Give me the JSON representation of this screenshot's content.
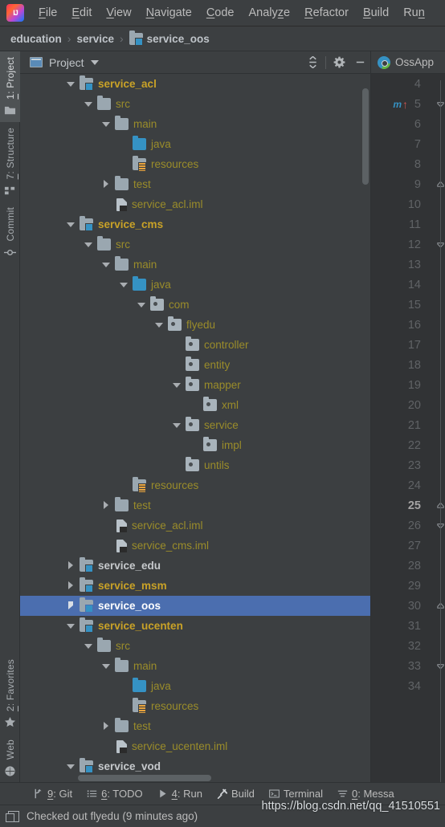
{
  "menu": {
    "logo_icon": "intellij-logo-icon",
    "items": [
      {
        "label": "File",
        "mnemonic": "F"
      },
      {
        "label": "Edit",
        "mnemonic": "E"
      },
      {
        "label": "View",
        "mnemonic": "V"
      },
      {
        "label": "Navigate",
        "mnemonic": "N"
      },
      {
        "label": "Code",
        "mnemonic": "C"
      },
      {
        "label": "Analyze",
        "mnemonic": "z"
      },
      {
        "label": "Refactor",
        "mnemonic": "R"
      },
      {
        "label": "Build",
        "mnemonic": "B"
      },
      {
        "label": "Run",
        "mnemonic": "n"
      }
    ]
  },
  "breadcrumb": {
    "separator": "›",
    "items": [
      {
        "label": "education",
        "icon": null
      },
      {
        "label": "service",
        "icon": null
      },
      {
        "label": "service_oos",
        "icon": "module-icon"
      }
    ]
  },
  "toolstrip": {
    "top": [
      {
        "label": "1: Project",
        "mnemonic": "1",
        "icon": "project-folder-icon",
        "active": true
      },
      {
        "label": "7: Structure",
        "mnemonic": "7",
        "icon": "structure-icon",
        "active": false
      },
      {
        "label": "Commit",
        "mnemonic": "",
        "icon": "commit-icon",
        "active": false
      }
    ],
    "bottom": [
      {
        "label": "2: Favorites",
        "mnemonic": "2",
        "icon": "star-icon",
        "active": false
      },
      {
        "label": "Web",
        "mnemonic": "",
        "icon": "globe-icon",
        "active": false
      }
    ]
  },
  "project_panel": {
    "title": "Project",
    "dropdown_caret_icon": "chevron-down-icon",
    "view_icon": "project-view-icon",
    "tools": [
      {
        "name": "collapse-all-button",
        "icon": "collapse-all-icon"
      },
      {
        "name": "settings-button",
        "icon": "gear-icon"
      },
      {
        "name": "hide-button",
        "icon": "minimize-icon"
      }
    ],
    "tree": [
      {
        "label": "service_acl",
        "depth": 1,
        "icon": "module",
        "twisty": "open",
        "color": "#c9a227",
        "bold": true,
        "selected": false
      },
      {
        "label": "src",
        "depth": 2,
        "icon": "folder",
        "twisty": "open",
        "color": "#9a8c2a",
        "bold": false,
        "selected": false
      },
      {
        "label": "main",
        "depth": 3,
        "icon": "folder",
        "twisty": "open",
        "color": "#9a8c2a",
        "bold": false,
        "selected": false
      },
      {
        "label": "java",
        "depth": 4,
        "icon": "source",
        "twisty": "none",
        "color": "#9a8c2a",
        "bold": false,
        "selected": false
      },
      {
        "label": "resources",
        "depth": 4,
        "icon": "resource",
        "twisty": "none",
        "color": "#9a8c2a",
        "bold": false,
        "selected": false
      },
      {
        "label": "test",
        "depth": 3,
        "icon": "folder",
        "twisty": "closed",
        "color": "#9a8c2a",
        "bold": false,
        "selected": false
      },
      {
        "label": "service_acl.iml",
        "depth": 3,
        "icon": "iml",
        "twisty": "none",
        "color": "#9a8c2a",
        "bold": false,
        "selected": false
      },
      {
        "label": "service_cms",
        "depth": 1,
        "icon": "module",
        "twisty": "open",
        "color": "#c9a227",
        "bold": true,
        "selected": false
      },
      {
        "label": "src",
        "depth": 2,
        "icon": "folder",
        "twisty": "open",
        "color": "#9a8c2a",
        "bold": false,
        "selected": false
      },
      {
        "label": "main",
        "depth": 3,
        "icon": "folder",
        "twisty": "open",
        "color": "#9a8c2a",
        "bold": false,
        "selected": false
      },
      {
        "label": "java",
        "depth": 4,
        "icon": "source",
        "twisty": "open",
        "color": "#9a8c2a",
        "bold": false,
        "selected": false
      },
      {
        "label": "com",
        "depth": 5,
        "icon": "package",
        "twisty": "open",
        "color": "#9a8c2a",
        "bold": false,
        "selected": false
      },
      {
        "label": "flyedu",
        "depth": 6,
        "icon": "package",
        "twisty": "open",
        "color": "#9a8c2a",
        "bold": false,
        "selected": false
      },
      {
        "label": "controller",
        "depth": 7,
        "icon": "package",
        "twisty": "none",
        "color": "#9a8c2a",
        "bold": false,
        "selected": false
      },
      {
        "label": "entity",
        "depth": 7,
        "icon": "package",
        "twisty": "none",
        "color": "#9a8c2a",
        "bold": false,
        "selected": false
      },
      {
        "label": "mapper",
        "depth": 7,
        "icon": "package",
        "twisty": "open",
        "color": "#9a8c2a",
        "bold": false,
        "selected": false
      },
      {
        "label": "xml",
        "depth": 8,
        "icon": "package",
        "twisty": "none",
        "color": "#9a8c2a",
        "bold": false,
        "selected": false
      },
      {
        "label": "service",
        "depth": 7,
        "icon": "package",
        "twisty": "open",
        "color": "#9a8c2a",
        "bold": false,
        "selected": false
      },
      {
        "label": "impl",
        "depth": 8,
        "icon": "package",
        "twisty": "none",
        "color": "#9a8c2a",
        "bold": false,
        "selected": false
      },
      {
        "label": "untils",
        "depth": 7,
        "icon": "package",
        "twisty": "none",
        "color": "#9a8c2a",
        "bold": false,
        "selected": false
      },
      {
        "label": "resources",
        "depth": 4,
        "icon": "resource",
        "twisty": "none",
        "color": "#9a8c2a",
        "bold": false,
        "selected": false
      },
      {
        "label": "test",
        "depth": 3,
        "icon": "folder",
        "twisty": "closed",
        "color": "#9a8c2a",
        "bold": false,
        "selected": false
      },
      {
        "label": "service_acl.iml",
        "depth": 3,
        "icon": "iml",
        "twisty": "none",
        "color": "#9a8c2a",
        "bold": false,
        "selected": false
      },
      {
        "label": "service_cms.iml",
        "depth": 3,
        "icon": "iml",
        "twisty": "none",
        "color": "#9a8c2a",
        "bold": false,
        "selected": false
      },
      {
        "label": "service_edu",
        "depth": 1,
        "icon": "module",
        "twisty": "closed",
        "color": "#c6c9cc",
        "bold": true,
        "selected": false
      },
      {
        "label": "service_msm",
        "depth": 1,
        "icon": "module",
        "twisty": "closed",
        "color": "#c9a227",
        "bold": true,
        "selected": false
      },
      {
        "label": "service_oos",
        "depth": 1,
        "icon": "module",
        "twisty": "closed",
        "color": "#ffffff",
        "bold": true,
        "selected": true
      },
      {
        "label": "service_ucenten",
        "depth": 1,
        "icon": "module",
        "twisty": "open",
        "color": "#c9a227",
        "bold": true,
        "selected": false
      },
      {
        "label": "src",
        "depth": 2,
        "icon": "folder",
        "twisty": "open",
        "color": "#9a8c2a",
        "bold": false,
        "selected": false
      },
      {
        "label": "main",
        "depth": 3,
        "icon": "folder",
        "twisty": "open",
        "color": "#9a8c2a",
        "bold": false,
        "selected": false
      },
      {
        "label": "java",
        "depth": 4,
        "icon": "source",
        "twisty": "none",
        "color": "#9a8c2a",
        "bold": false,
        "selected": false
      },
      {
        "label": "resources",
        "depth": 4,
        "icon": "resource",
        "twisty": "none",
        "color": "#9a8c2a",
        "bold": false,
        "selected": false
      },
      {
        "label": "test",
        "depth": 3,
        "icon": "folder",
        "twisty": "closed",
        "color": "#9a8c2a",
        "bold": false,
        "selected": false
      },
      {
        "label": "service_ucenten.iml",
        "depth": 3,
        "icon": "iml",
        "twisty": "none",
        "color": "#9a8c2a",
        "bold": false,
        "selected": false
      },
      {
        "label": "service_vod",
        "depth": 1,
        "icon": "module",
        "twisty": "open",
        "color": "#c6c9cc",
        "bold": true,
        "selected": false
      }
    ]
  },
  "editor": {
    "tab": {
      "label": "OssApp",
      "icon": "spring-boot-icon"
    },
    "current_line": 25,
    "lines": [
      4,
      5,
      6,
      7,
      8,
      9,
      10,
      11,
      12,
      13,
      14,
      15,
      16,
      17,
      18,
      19,
      20,
      21,
      22,
      23,
      24,
      25,
      26,
      27,
      28,
      29,
      30,
      31,
      32,
      33,
      34
    ],
    "gutter_markers": [
      {
        "line": 5,
        "icon": "override-method-icon",
        "glyph": "m",
        "arrow": "↑"
      }
    ],
    "fold_markers": [
      {
        "line": 5,
        "icon": "fold-end-icon"
      },
      {
        "line": 9,
        "icon": "fold-start-icon"
      },
      {
        "line": 12,
        "icon": "fold-end-icon"
      },
      {
        "line": 25,
        "icon": "fold-start-icon"
      },
      {
        "line": 26,
        "icon": "fold-end-icon"
      },
      {
        "line": 30,
        "icon": "fold-start-icon"
      },
      {
        "line": 33,
        "icon": "fold-end-icon"
      }
    ]
  },
  "tool_window_bar": [
    {
      "label": "9: Git",
      "mnemonic": "9",
      "icon": "git-branch-icon"
    },
    {
      "label": "6: TODO",
      "mnemonic": "6",
      "icon": "todo-list-icon"
    },
    {
      "label": "4: Run",
      "mnemonic": "4",
      "icon": "run-play-icon"
    },
    {
      "label": "Build",
      "mnemonic": "",
      "icon": "build-hammer-icon"
    },
    {
      "label": "Terminal",
      "mnemonic": "",
      "icon": "terminal-icon"
    },
    {
      "label": "0: Messa",
      "mnemonic": "0",
      "icon": "messages-icon"
    }
  ],
  "status_bar": {
    "icon": "vcs-window-icon",
    "message": "Checked out flyedu (9 minutes ago)"
  },
  "watermark": "https://blog.csdn.net/qq_41510551"
}
